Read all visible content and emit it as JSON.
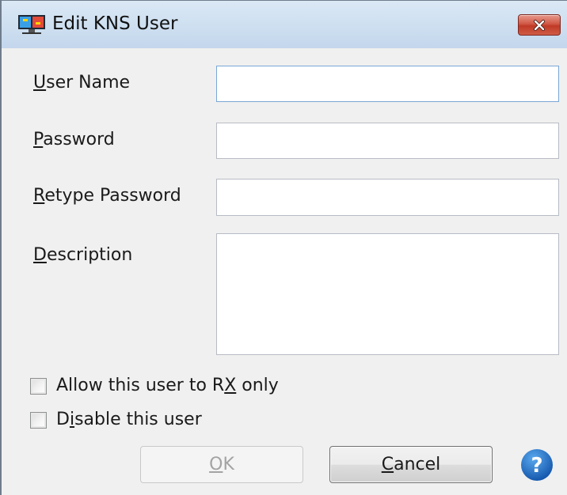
{
  "window": {
    "title": "Edit KNS User"
  },
  "colors": {
    "title_bar": "#cddff0",
    "close_button": "#c94f3b",
    "help_icon": "#1f6fc5"
  },
  "icons": {
    "app": "monitor-app-icon",
    "close": "close-icon",
    "help": "help-icon"
  },
  "form": {
    "user_name": {
      "label_key": "U",
      "label_rest": "ser Name",
      "value": ""
    },
    "password": {
      "label_key": "P",
      "label_rest": "assword",
      "value": ""
    },
    "retype_password": {
      "label_key": "R",
      "label_rest": "etype Password",
      "value": ""
    },
    "description": {
      "label_key": "D",
      "label_rest": "escription",
      "value": ""
    }
  },
  "options": {
    "rx_only": {
      "label_pre": "Allow this user to R",
      "label_key": "X",
      "label_post": " only",
      "checked": false
    },
    "disable": {
      "label_pre": "D",
      "label_key": "i",
      "label_post": "sable this user",
      "checked": false
    }
  },
  "buttons": {
    "ok": {
      "label_key": "O",
      "label_rest": "K",
      "enabled": false
    },
    "cancel": {
      "label_key": "C",
      "label_rest": "ancel",
      "enabled": true
    }
  }
}
